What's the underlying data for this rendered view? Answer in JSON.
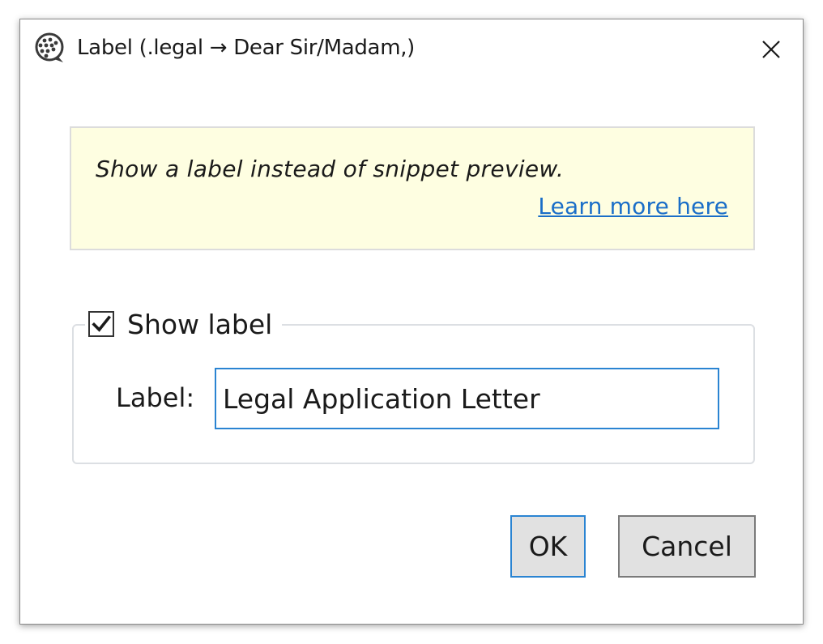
{
  "window": {
    "title": "Label (.legal → Dear Sir/Madam,)",
    "icon": "speech-bubble-dots-icon",
    "close_icon": "close-icon"
  },
  "info": {
    "text": "Show a label instead of snippet preview.",
    "link_text": "Learn more here",
    "background_color": "#fefee1",
    "link_color": "#1a6ec8"
  },
  "group": {
    "checkbox_label": "Show label",
    "checked": true,
    "field_label": "Label:",
    "field_value": "Legal Application Letter"
  },
  "buttons": {
    "ok_label": "OK",
    "cancel_label": "Cancel"
  },
  "colors": {
    "accent": "#2a84d2",
    "button_bg": "#e1e1e1"
  }
}
